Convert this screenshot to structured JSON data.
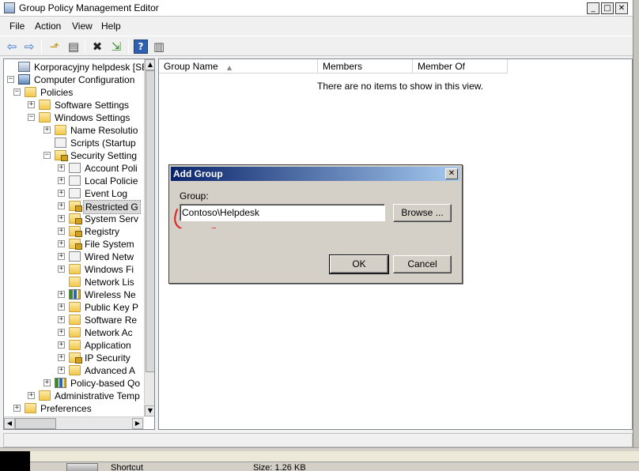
{
  "window": {
    "title": "Group Policy Management Editor",
    "controls": {
      "minimize": "_",
      "maximize": "□",
      "close": "✕"
    }
  },
  "menu": [
    "File",
    "Action",
    "View",
    "Help"
  ],
  "toolbar": {
    "icons": [
      "back-arrow-icon",
      "forward-arrow-icon",
      "up-folder-icon",
      "show-hide-tree-icon",
      "delete-icon",
      "export-list-icon",
      "help-icon",
      "properties-icon"
    ],
    "glyphs": {
      "back": "⇦",
      "forward": "⇨",
      "up": "⬏",
      "tree": "▤",
      "delete": "✖",
      "export": "⇲",
      "help": "?",
      "props": "▥"
    }
  },
  "tree": {
    "items": [
      {
        "label": "Korporacyjny helpdesk [SERVER",
        "level": 0,
        "expander": "",
        "icon": "policy"
      },
      {
        "label": "Computer Configuration",
        "level": 0,
        "expander": "−",
        "icon": "computer"
      },
      {
        "label": "Policies",
        "level": 1,
        "expander": "−",
        "icon": "folder"
      },
      {
        "label": "Software Settings",
        "level": 2,
        "expander": "+",
        "icon": "folder"
      },
      {
        "label": "Windows Settings",
        "level": 2,
        "expander": "−",
        "icon": "folder"
      },
      {
        "label": "Name Resolutio",
        "level": 3,
        "expander": "+",
        "icon": "folder"
      },
      {
        "label": "Scripts (Startup",
        "level": 3,
        "expander": "",
        "icon": "doc"
      },
      {
        "label": "Security Setting",
        "level": 3,
        "expander": "−",
        "icon": "lock"
      },
      {
        "label": "Account Poli",
        "level": 4,
        "expander": "+",
        "icon": "doc"
      },
      {
        "label": "Local Policie",
        "level": 4,
        "expander": "+",
        "icon": "doc"
      },
      {
        "label": "Event Log",
        "level": 4,
        "expander": "+",
        "icon": "doc"
      },
      {
        "label": "Restricted G",
        "level": 4,
        "expander": "+",
        "icon": "lock",
        "selected": true
      },
      {
        "label": "System Serv",
        "level": 4,
        "expander": "+",
        "icon": "lock"
      },
      {
        "label": "Registry",
        "level": 4,
        "expander": "+",
        "icon": "lock"
      },
      {
        "label": "File System",
        "level": 4,
        "expander": "+",
        "icon": "lock"
      },
      {
        "label": "Wired Netw",
        "level": 4,
        "expander": "+",
        "icon": "doc"
      },
      {
        "label": "Windows Fi",
        "level": 4,
        "expander": "+",
        "icon": "folder"
      },
      {
        "label": "Network Lis",
        "level": 4,
        "expander": "",
        "icon": "folder"
      },
      {
        "label": "Wireless Ne",
        "level": 4,
        "expander": "+",
        "icon": "chart"
      },
      {
        "label": "Public Key P",
        "level": 4,
        "expander": "+",
        "icon": "folder"
      },
      {
        "label": "Software Re",
        "level": 4,
        "expander": "+",
        "icon": "folder"
      },
      {
        "label": "Network Ac",
        "level": 4,
        "expander": "+",
        "icon": "folder"
      },
      {
        "label": "Application",
        "level": 4,
        "expander": "+",
        "icon": "folder"
      },
      {
        "label": "IP Security",
        "level": 4,
        "expander": "+",
        "icon": "lock"
      },
      {
        "label": "Advanced A",
        "level": 4,
        "expander": "+",
        "icon": "folder"
      },
      {
        "label": "Policy-based Qo",
        "level": 3,
        "expander": "+",
        "icon": "chart"
      },
      {
        "label": "Administrative Temp",
        "level": 2,
        "expander": "+",
        "icon": "folder"
      },
      {
        "label": "Preferences",
        "level": 1,
        "expander": "+",
        "icon": "folder"
      }
    ]
  },
  "list": {
    "columns": [
      "Group Name",
      "Members",
      "Member Of"
    ],
    "sort_glyph": "▲",
    "empty_message": "There are no items to show in this view."
  },
  "dialog": {
    "title": "Add Group",
    "group_label": "Group:",
    "group_value": "Contoso\\Helpdesk",
    "browse_label": "Browse ...",
    "ok_label": "OK",
    "cancel_label": "Cancel",
    "annotation_color": "#e02020"
  },
  "background_window": {
    "type_text": "Shortcut",
    "size_text": "Size: 1.26 KB"
  }
}
